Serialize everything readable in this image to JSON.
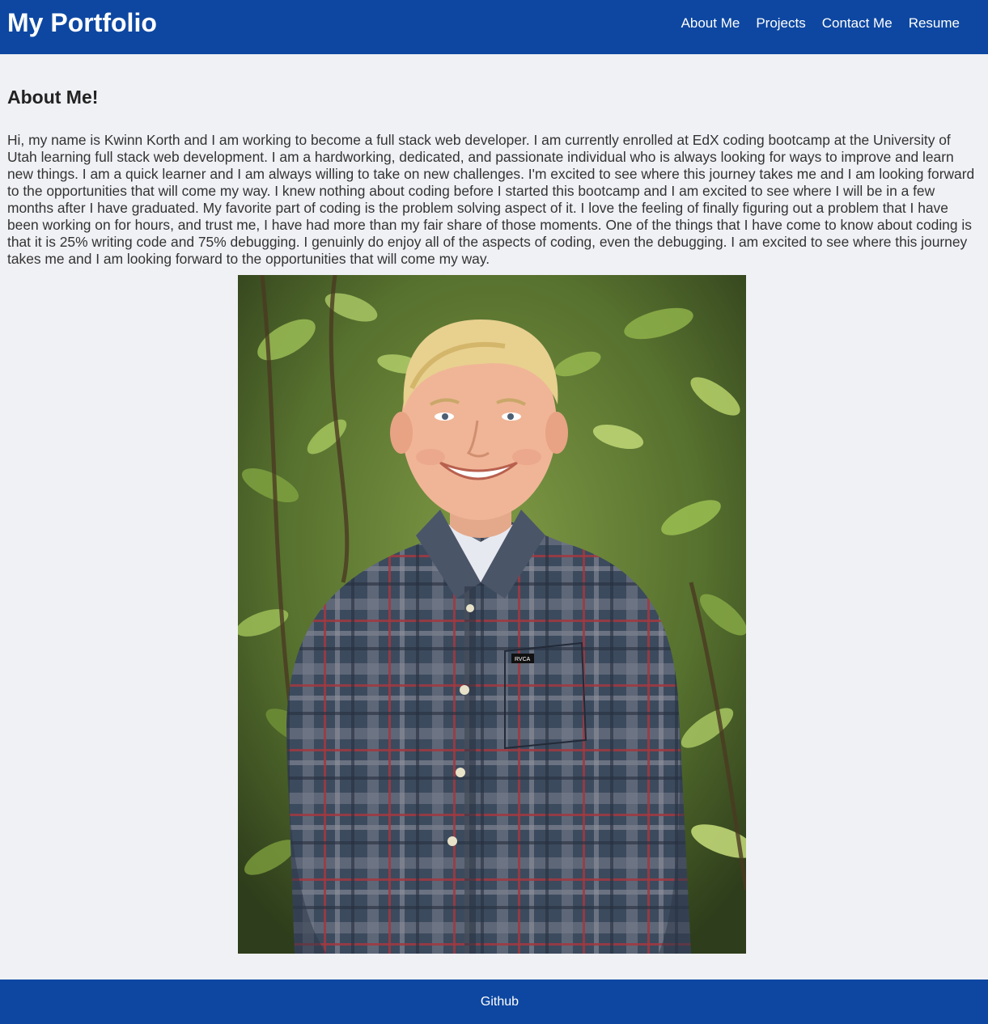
{
  "header": {
    "title": "My Portfolio",
    "nav": [
      {
        "label": "About Me"
      },
      {
        "label": "Projects"
      },
      {
        "label": "Contact Me"
      },
      {
        "label": "Resume"
      }
    ]
  },
  "main": {
    "heading": "About Me!",
    "paragraph": "Hi, my name is Kwinn Korth and I am working to become a full stack web developer. I am currently enrolled at EdX coding bootcamp at the University of Utah learning full stack web development. I am a hardworking, dedicated, and passionate individual who is always looking for ways to improve and learn new things. I am a quick learner and I am always willing to take on new challenges. I'm excited to see where this journey takes me and I am looking forward to the opportunities that will come my way. I knew nothing about coding before I started this bootcamp and I am excited to see where I will be in a few months after I have graduated. My favorite part of coding is the problem solving aspect of it. I love the feeling of finally figuring out a problem that I have been working on for hours, and trust me, I have had more than my fair share of those moments. One of the things that I have come to know about coding is that it is 25% writing code and 75% debugging. I genuinly do enjoy all of the aspects of coding, even the debugging. I am excited to see where this journey takes me and I am looking forward to the opportunities that will come my way.",
    "photo": {
      "subject": "portrait photo of smiling person in plaid shirt in front of green foliage",
      "shirt_logo": "RVCA"
    }
  },
  "footer": {
    "link": "Github"
  },
  "colors": {
    "brand": "#0d47a1",
    "background": "#f0f1f5",
    "text": "#333333"
  }
}
